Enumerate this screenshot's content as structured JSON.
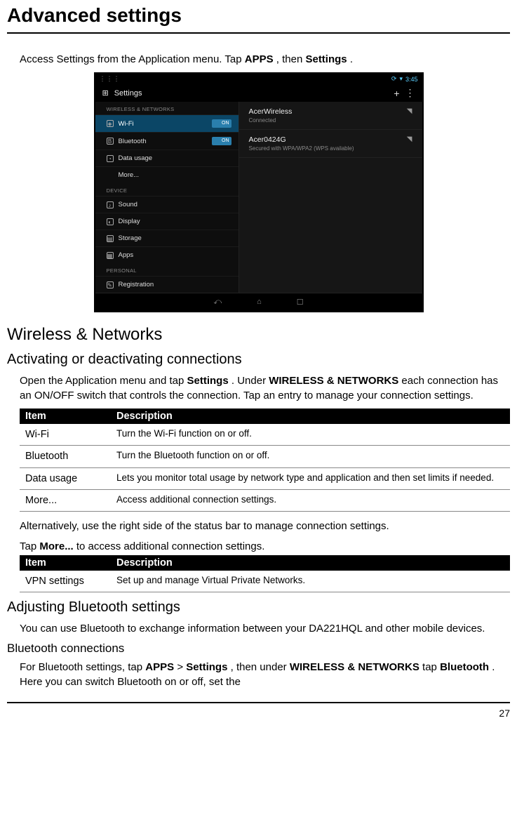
{
  "page_title": "Advanced settings",
  "intro_pre": "Access Settings from the Application menu. Tap ",
  "intro_b1": "APPS",
  "intro_mid": ", then ",
  "intro_b2": "Settings",
  "intro_post": ".",
  "screenshot": {
    "status_time": "3:45",
    "settings_label": "Settings",
    "categories": {
      "wireless": "WIRELESS & NETWORKS",
      "device": "DEVICE",
      "personal": "PERSONAL"
    },
    "left_items": {
      "wifi": "Wi-Fi",
      "bluetooth": "Bluetooth",
      "data_usage": "Data usage",
      "more": "More...",
      "sound": "Sound",
      "display": "Display",
      "storage": "Storage",
      "apps": "Apps",
      "registration": "Registration"
    },
    "toggle_on": "ON",
    "networks": {
      "n1_title": "AcerWireless",
      "n1_sub": "Connected",
      "n2_title": "Acer0424G",
      "n2_sub": "Secured with WPA/WPA2 (WPS available)"
    }
  },
  "h2_wireless": "Wireless & Networks",
  "h3_activating": "Activating or deactivating connections",
  "p_activating_pre": "Open the Application menu and tap ",
  "p_activating_b1": "Settings",
  "p_activating_mid": ". Under ",
  "p_activating_b2": "WIRELESS & NETWORKS",
  "p_activating_post": " each connection has an ON/OFF switch that controls the connection. Tap an entry to manage your connection settings.",
  "table_headers": {
    "item": "Item",
    "desc": "Description"
  },
  "table1": [
    {
      "item": "Wi-Fi",
      "desc": "Turn the Wi-Fi function on or off."
    },
    {
      "item": "Bluetooth",
      "desc": "Turn the Bluetooth function on or off."
    },
    {
      "item": "Data usage",
      "desc": "Lets you monitor total usage by network type and application and then set limits if needed."
    },
    {
      "item": "More...",
      "desc": "Access additional connection settings."
    }
  ],
  "p_alt": "Alternatively, use the right side of the status bar to manage connection settings.",
  "p_more_pre": "Tap ",
  "p_more_b": "More...",
  "p_more_post": " to access additional connection settings.",
  "table2": [
    {
      "item": "VPN settings",
      "desc": "Set up and manage Virtual Private Networks."
    }
  ],
  "h3_bt": "Adjusting Bluetooth settings",
  "p_bt": "You can use Bluetooth to exchange information between your DA221HQL and other mobile devices.",
  "h4_btconn": "Bluetooth connections",
  "p_btconn_pre": "For Bluetooth settings, tap ",
  "p_btconn_b1": "APPS",
  "p_btconn_mid1": " > ",
  "p_btconn_b2": "Settings",
  "p_btconn_mid2": ", then under ",
  "p_btconn_b3": "WIRELESS & NETWORKS",
  "p_btconn_mid3": " tap ",
  "p_btconn_b4": "Bluetooth",
  "p_btconn_post": ". Here you can switch Bluetooth on or off, set the",
  "page_number": "27"
}
